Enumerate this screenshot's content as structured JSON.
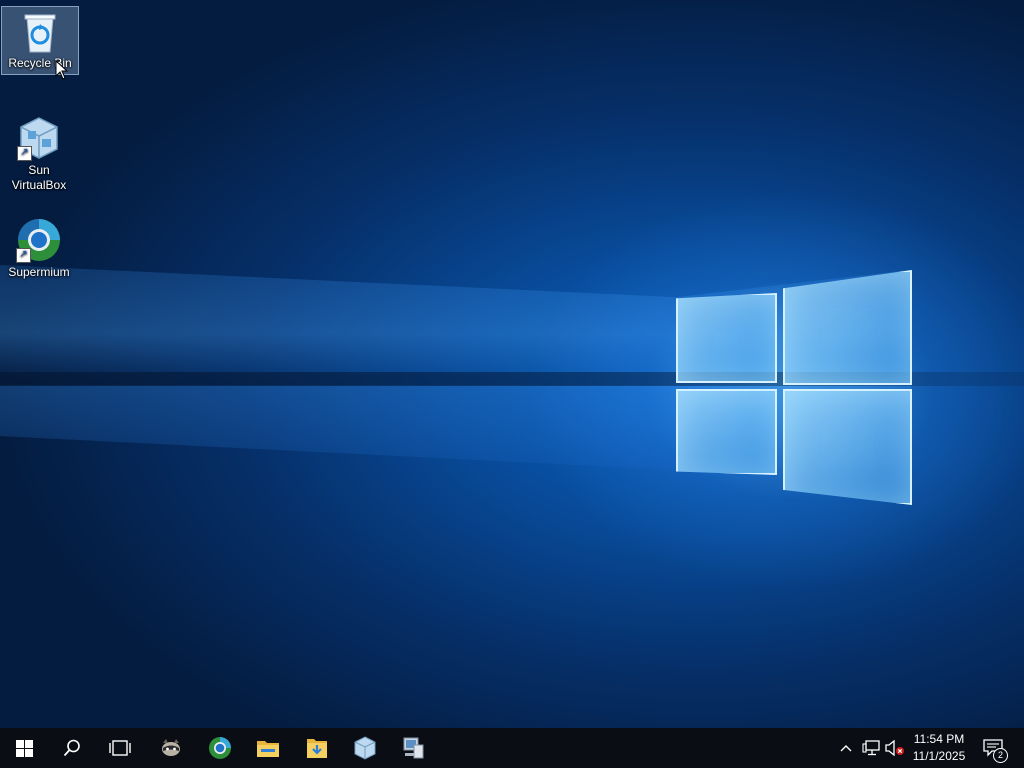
{
  "desktop": {
    "icons": [
      {
        "label": "Recycle Bin",
        "icon": "recycle-bin-icon",
        "selected": true
      },
      {
        "label": "Sun\nVirtualBox",
        "icon": "virtualbox-icon",
        "shortcut": true
      },
      {
        "label": "Supermium",
        "icon": "supermium-icon",
        "shortcut": true
      }
    ],
    "wallpaper_colors": {
      "deep": "#041c40",
      "mid": "#0b63c4",
      "glow": "#8fd3ff"
    }
  },
  "taskbar": {
    "buttons": [
      {
        "name": "start",
        "icon": "windows-logo-icon"
      },
      {
        "name": "search",
        "icon": "search-icon"
      },
      {
        "name": "task-view",
        "icon": "task-view-icon"
      },
      {
        "name": "raccoon-app",
        "icon": "raccoon-icon"
      },
      {
        "name": "supermium",
        "icon": "supermium-icon"
      },
      {
        "name": "file-explorer",
        "icon": "folder-icon"
      },
      {
        "name": "downloads",
        "icon": "download-folder-icon"
      },
      {
        "name": "virtualbox",
        "icon": "virtualbox-icon"
      },
      {
        "name": "computer",
        "icon": "computer-icon"
      }
    ],
    "tray": {
      "icons": [
        "chevron-up-icon",
        "network-icon",
        "volume-muted-icon"
      ],
      "time": "11:54 PM",
      "date": "11/1/2025",
      "notification_count": "2"
    },
    "colors": {
      "background": "#0a0d14"
    }
  }
}
